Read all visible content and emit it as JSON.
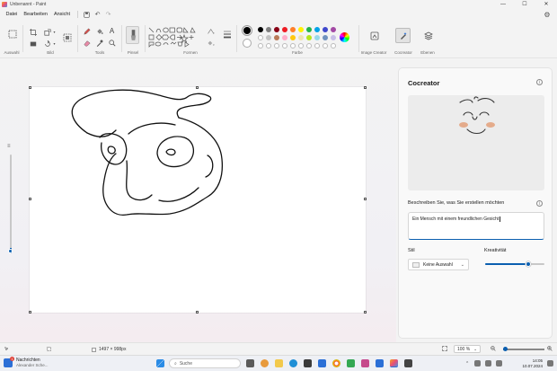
{
  "window": {
    "title": "Unbenannt - Paint",
    "controls": [
      "—",
      "☐",
      "✕"
    ]
  },
  "menu": {
    "items": [
      "Datei",
      "Bearbeiten",
      "Ansicht"
    ]
  },
  "ribbon": {
    "groups": {
      "selection": "Auswahl",
      "image": "Bild",
      "tools": "Tools",
      "brushes": "Pinsel",
      "shapes": "Formen",
      "colors": "Farbe",
      "image_creator": "Image Creator",
      "cocreator": "Cocreator",
      "layers": "Ebenen"
    },
    "active_color": "#000000",
    "palette": [
      "#000000",
      "#7f7f7f",
      "#880015",
      "#ed1c24",
      "#ff7f27",
      "#fff200",
      "#22b14c",
      "#00a2e8",
      "#3f48cc",
      "#a349a4",
      "#ffffff",
      "#c3c3c3",
      "#b97a57",
      "#ffaec9",
      "#ffc90e",
      "#efe4b0",
      "#b5e61d",
      "#99d9ea",
      "#7092be",
      "#c8bfe7"
    ]
  },
  "status": {
    "canvas_size": "1497 × 998px",
    "zoom": "100 %",
    "zoom_level": 0.05
  },
  "side_zoom_level": 0.05,
  "cocreator": {
    "title": "Cocreator",
    "describe_label": "Beschreiben Sie, was Sie erstellen möchten",
    "prompt": "Ein Mensch mit einem freundlichen Gesicht",
    "style_label": "Stil",
    "style_value": "Keine Auswahl",
    "creativity_label": "Kreativität",
    "creativity_level": 0.72
  },
  "taskbar": {
    "news_title": "Nachrichten",
    "news_sub": "Alexander Sche...",
    "news_badge": "1",
    "search_placeholder": "Suche",
    "time": "14:05",
    "date": "10.07.2024"
  }
}
